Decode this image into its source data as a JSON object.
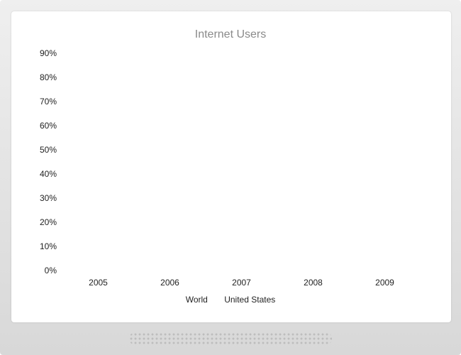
{
  "chart_data": {
    "type": "bar",
    "title": "Internet Users",
    "categories": [
      "2005",
      "2006",
      "2007",
      "2008",
      "2009"
    ],
    "y_ticks": [
      "0%",
      "10%",
      "20%",
      "30%",
      "40%",
      "50%",
      "60%",
      "70%",
      "80%",
      "90%"
    ],
    "ylim": [
      0,
      90
    ],
    "series": [
      {
        "name": "World",
        "values": []
      },
      {
        "name": "United States",
        "values": []
      }
    ],
    "grid": false,
    "legend_position": "bottom"
  }
}
